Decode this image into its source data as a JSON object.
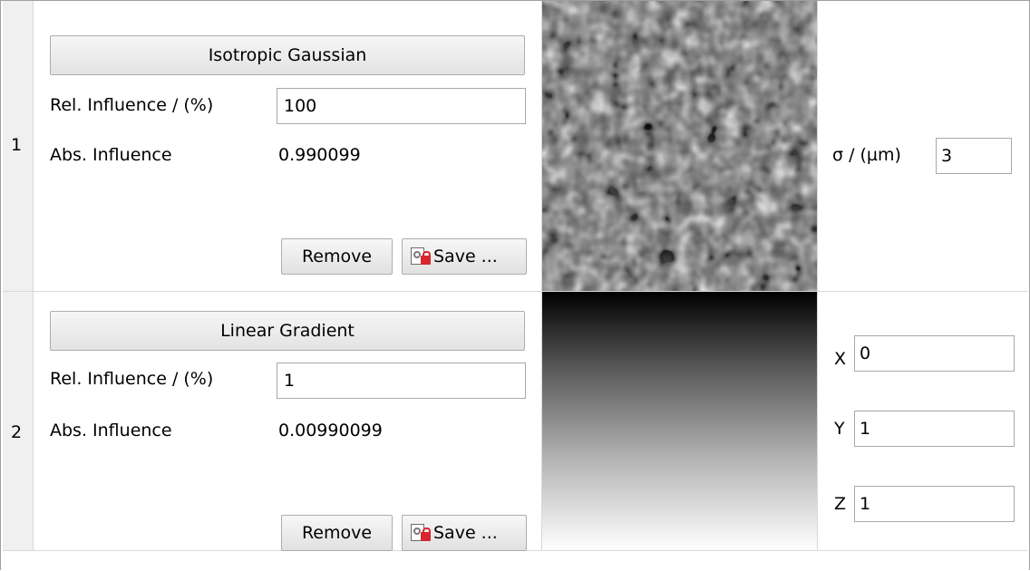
{
  "rows": [
    {
      "index": "1",
      "title": "Isotropic Gaussian",
      "rel_label": "Rel. Influence / (%)",
      "rel_value": "100",
      "abs_label": "Abs. Influence",
      "abs_value": "0.990099",
      "remove_label": "Remove",
      "save_label": "Save ...",
      "preview": "gaussian-noise-preview",
      "params": [
        {
          "label": "σ / (µm)",
          "value": "3"
        }
      ]
    },
    {
      "index": "2",
      "title": "Linear Gradient",
      "rel_label": "Rel. Influence / (%)",
      "rel_value": "1",
      "abs_label": "Abs. Influence",
      "abs_value": "0.00990099",
      "remove_label": "Remove",
      "save_label": "Save ...",
      "preview": "linear-gradient-preview",
      "params": [
        {
          "label": "X",
          "value": "0"
        },
        {
          "label": "Y",
          "value": "1"
        },
        {
          "label": "Z",
          "value": "1"
        }
      ]
    }
  ],
  "icons": {
    "save": "save-icon"
  },
  "colors": {
    "grid_line": "#d8d8d8",
    "header_bg": "#f0f0f0",
    "lock_red": "#d8262d"
  }
}
